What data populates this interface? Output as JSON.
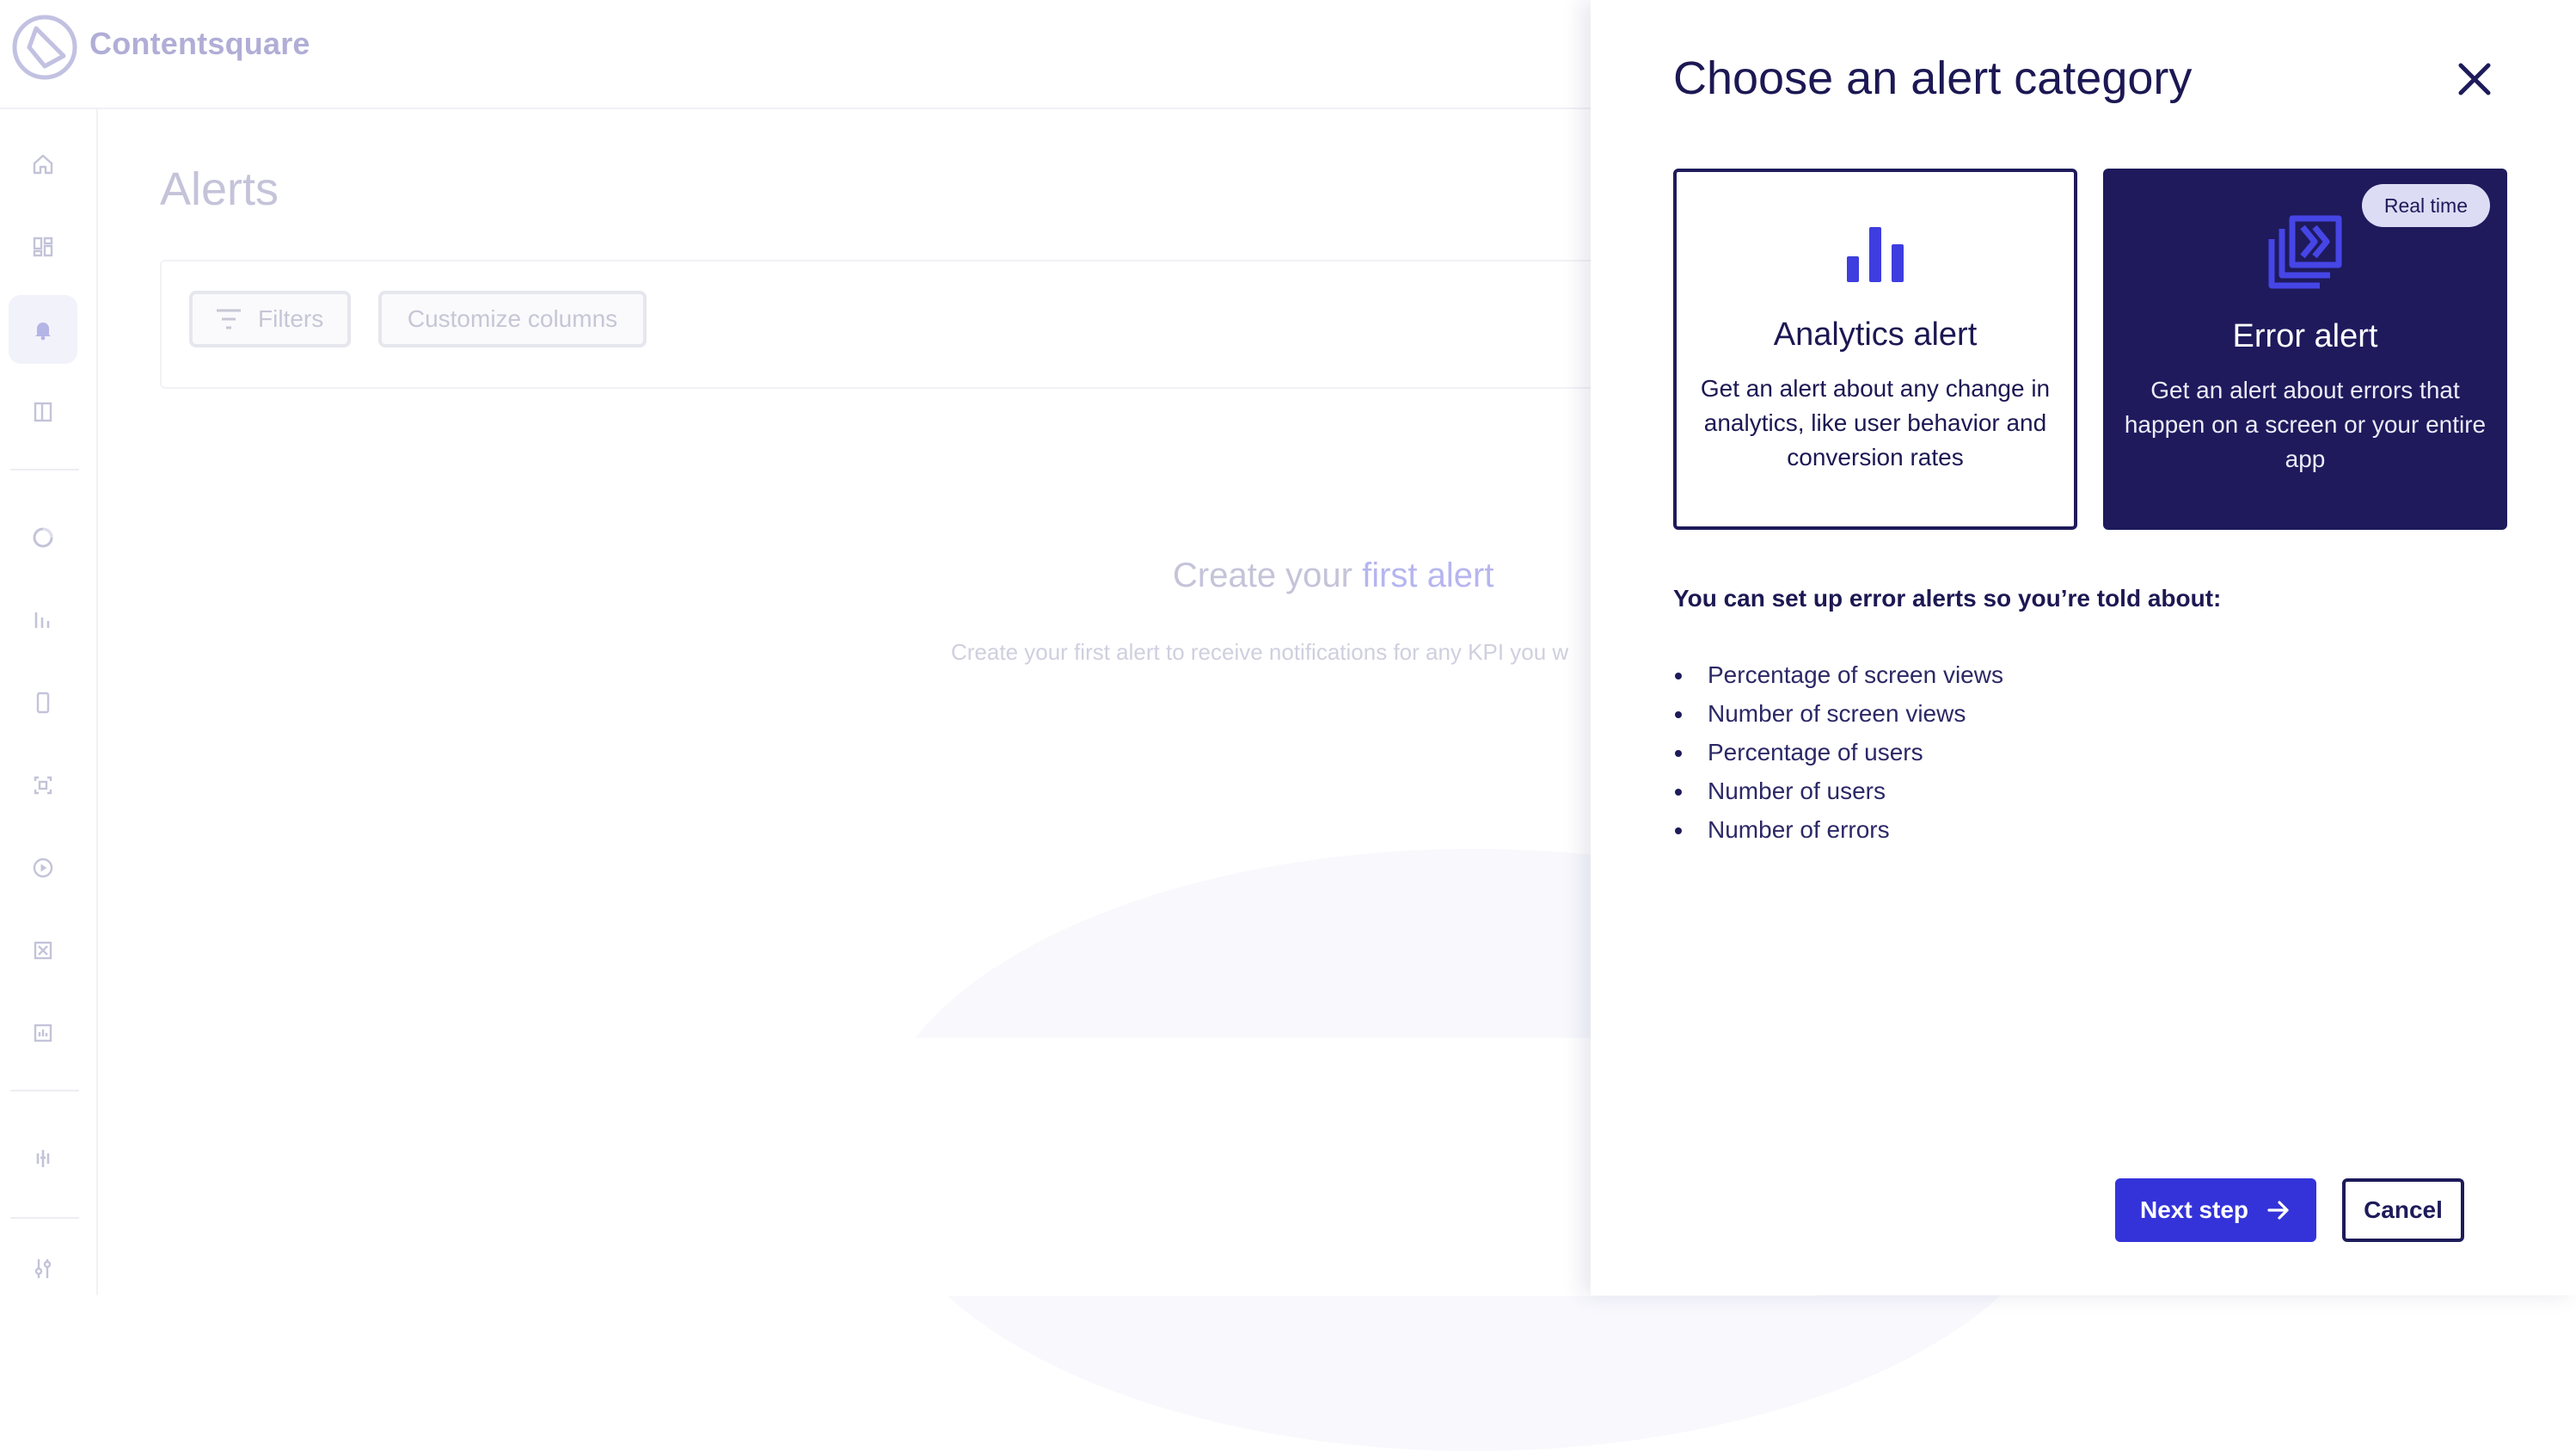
{
  "app": {
    "logo_text": "Contentsquare",
    "page_title": "Alerts",
    "toolbar": {
      "filters_label": "Filters",
      "customize_columns_label": "Customize columns"
    },
    "empty_state": {
      "title_prefix": "Create your ",
      "title_accent": "first alert",
      "description": "Create your first alert to receive notifications for any KPI you w"
    },
    "sidebar": {
      "items": [
        {
          "icon": "home-icon"
        },
        {
          "icon": "dashboard-icon"
        },
        {
          "icon": "bell-icon",
          "active": true
        },
        {
          "icon": "book-icon"
        },
        {
          "icon": "journey-icon"
        },
        {
          "icon": "bar-chart-icon"
        },
        {
          "icon": "mobile-icon"
        },
        {
          "icon": "zone-icon"
        },
        {
          "icon": "play-icon"
        },
        {
          "icon": "compare-icon"
        },
        {
          "icon": "report-icon"
        },
        {
          "icon": "impact-icon"
        },
        {
          "icon": "settings-sliders-icon"
        }
      ]
    }
  },
  "drawer": {
    "title": "Choose an alert category",
    "cards": {
      "analytics": {
        "title": "Analytics alert",
        "description": "Get an alert about any change in analytics, like user behavior and conversion rates",
        "icon": "bar-chart-icon",
        "selected": false
      },
      "error": {
        "title": "Error alert",
        "description": "Get an alert about errors that happen on a screen or your entire app",
        "badge": "Real time",
        "icon": "error-pages-icon",
        "selected": true
      }
    },
    "intro": "You can set up error alerts so you’re told about:",
    "metrics": [
      "Percentage of screen views",
      "Number of screen views",
      "Percentage of users",
      "Number of users",
      "Number of errors"
    ],
    "next_label": "Next step",
    "cancel_label": "Cancel"
  },
  "colors": {
    "primary": "#3433d9",
    "navy": "#1e1a5c",
    "badge_bg": "#dcdcf5"
  }
}
